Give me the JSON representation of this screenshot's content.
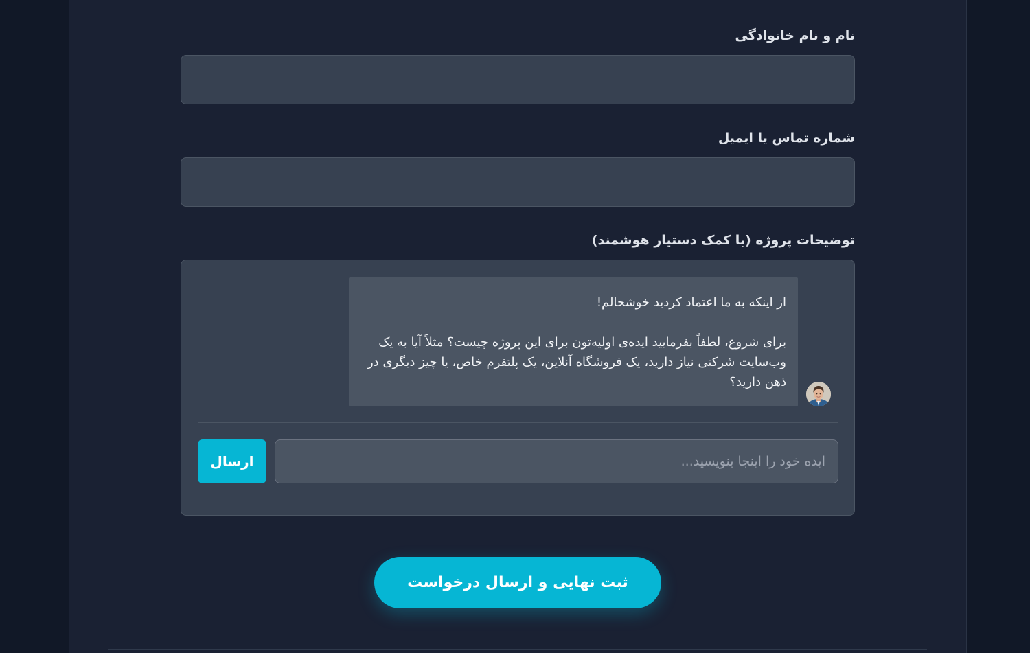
{
  "form": {
    "name_label": "نام و نام خانوادگی",
    "contact_label": "شماره تماس یا ایمیل",
    "description_label": "توضیحات پروژه (با کمک دستیار هوشمند)"
  },
  "chat": {
    "greeting": "از اینکه به ما اعتماد کردید خوشحالم!",
    "message": "برای شروع، لطفاً بفرمایید ایده‌ی اولیه‌تون برای این پروژه چیست؟ مثلاً آیا به یک وب‌سایت شرکتی نیاز دارید، یک فروشگاه آنلاین، یک پلتفرم خاص، یا چیز دیگری در ذهن دارید؟",
    "input_placeholder": "ایده خود را اینجا بنویسید...",
    "send_label": "ارسال",
    "avatar_icon": "user-avatar-photo"
  },
  "submit": {
    "label": "ثبت نهایی و ارسال درخواست"
  },
  "colors": {
    "background": "#111827",
    "panel": "#1a2133",
    "input": "#374151",
    "bubble": "#4b5563",
    "accent": "#06b6d4"
  }
}
